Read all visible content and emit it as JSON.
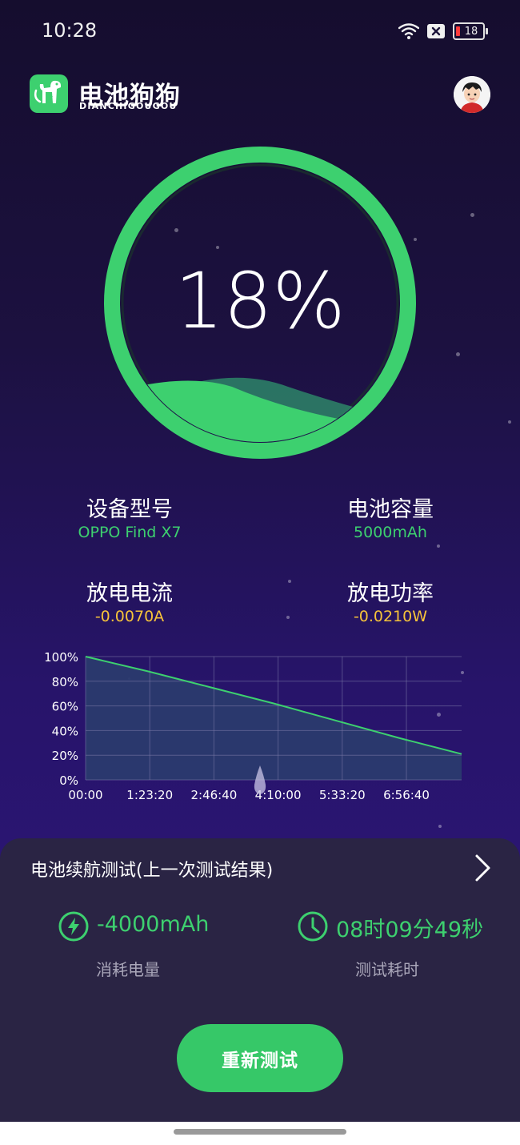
{
  "status_bar": {
    "time": "10:28",
    "battery_level": "18",
    "icons": [
      "wifi-icon",
      "sim-off-icon",
      "battery-icon"
    ]
  },
  "header": {
    "brand_cn": "电池狗狗",
    "brand_en": "DIANCHIGOUGOU",
    "logo_icon": "dog-battery-logo-icon",
    "avatar_icon": "user-avatar-icon"
  },
  "gauge": {
    "percent_text": "18%",
    "level": 0.18,
    "color": "#3dd06f"
  },
  "info": {
    "device_model": {
      "label": "设备型号",
      "value": "OPPO Find X7"
    },
    "battery_capacity": {
      "label": "电池容量",
      "value": "5000mAh"
    },
    "discharge_current": {
      "label": "放电电流",
      "value": "-0.0070A"
    },
    "discharge_power": {
      "label": "放电功率",
      "value": "-0.0210W"
    }
  },
  "chart_data": {
    "type": "area",
    "x": [
      "00:00",
      "1:23:20",
      "2:46:40",
      "4:10:00",
      "5:33:20",
      "6:56:40",
      "8:09:49"
    ],
    "x_tick_labels": [
      "00:00",
      "1:23:20",
      "2:46:40",
      "4:10:00",
      "5:33:20",
      "6:56:40"
    ],
    "y_tick_labels": [
      "100%",
      "80%",
      "60%",
      "40%",
      "20%",
      "0%"
    ],
    "values": [
      100,
      88,
      75,
      62,
      48,
      34,
      21
    ],
    "ylim": [
      0,
      100
    ],
    "grid": true,
    "line_color": "#3dd06f",
    "fill_color": "#2a3a6e"
  },
  "panel": {
    "title": "电池续航测试(上一次测试结果)",
    "consumed_value": "-4000mAh",
    "consumed_label": "消耗电量",
    "duration_value": "08时09分49秒",
    "duration_label": "测试耗时",
    "retest_label": "重新测试"
  }
}
